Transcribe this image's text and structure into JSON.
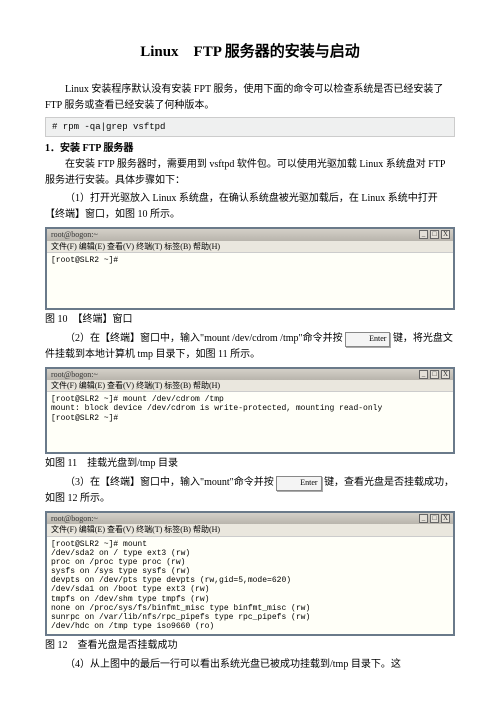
{
  "title": "Linux　FTP 服务器的安装与启动",
  "intro": "Linux 安装程序默认没有安装 FPT 服务，使用下面的命令可以检查系统是否已经安装了 FTP 服务或查看已经安装了何种版本。",
  "cmd_check": "# rpm -qa|grep vsftpd",
  "sect1": "1．安装 FTP 服务器",
  "sect1_intro": "在安装 FTP 服务器时，需要用到 vsftpd 软件包。可以使用光驱加载 Linux 系统盘对 FTP 服务进行安装。具体步骤如下：",
  "step1": "（1）打开光驱放入 Linux 系统盘，在确认系统盘被光驱加载后，在 Linux 系统中打开【终端】窗口，如图 10 所示。",
  "term": {
    "titlebar": "root@bogon:~",
    "menu": "文件(F)  编辑(E)  查看(V)  终端(T)  标签(B)  帮助(H)",
    "winmin": "_",
    "winmax": "□",
    "winclose": "X"
  },
  "term1_body": "[root@SLR2 ~]#\n",
  "cap10": "图 10　【终端】窗口",
  "step2a": "（2）在【终端】窗口中，输入\"mount /dev/cdrom /tmp\"命令并按",
  "key_enter": "Enter",
  "step2b": "键，将光盘文件挂载到本地计算机 tmp 目录下，如图 11 所示。",
  "term2_body": "[root@SLR2 ~]# mount /dev/cdrom /tmp\nmount: block device /dev/cdrom is write-protected, mounting read-only\n[root@SLR2 ~]#\n",
  "cap11": "如图 11　挂载光盘到/tmp 目录",
  "step3a": "（3）在【终端】窗口中，输入\"mount\"命令并按 ",
  "step3b": " 键，查看光盘是否挂载成功，如图 12 所示。",
  "term3_body": "[root@SLR2 ~]# mount\n/dev/sda2 on / type ext3 (rw)\nproc on /proc type proc (rw)\nsysfs on /sys type sysfs (rw)\ndevpts on /dev/pts type devpts (rw,gid=5,mode=620)\n/dev/sda1 on /boot type ext3 (rw)\ntmpfs on /dev/shm type tmpfs (rw)\nnone on /proc/sys/fs/binfmt_misc type binfmt_misc (rw)\nsunrpc on /var/lib/nfs/rpc_pipefs type rpc_pipefs (rw)\n/dev/hdc on /tmp type iso9660 (ro)\n",
  "cap12": "图 12　查看光盘是否挂载成功",
  "step4": "（4）从上图中的最后一行可以看出系统光盘已被成功挂载到/tmp 目录下。这"
}
